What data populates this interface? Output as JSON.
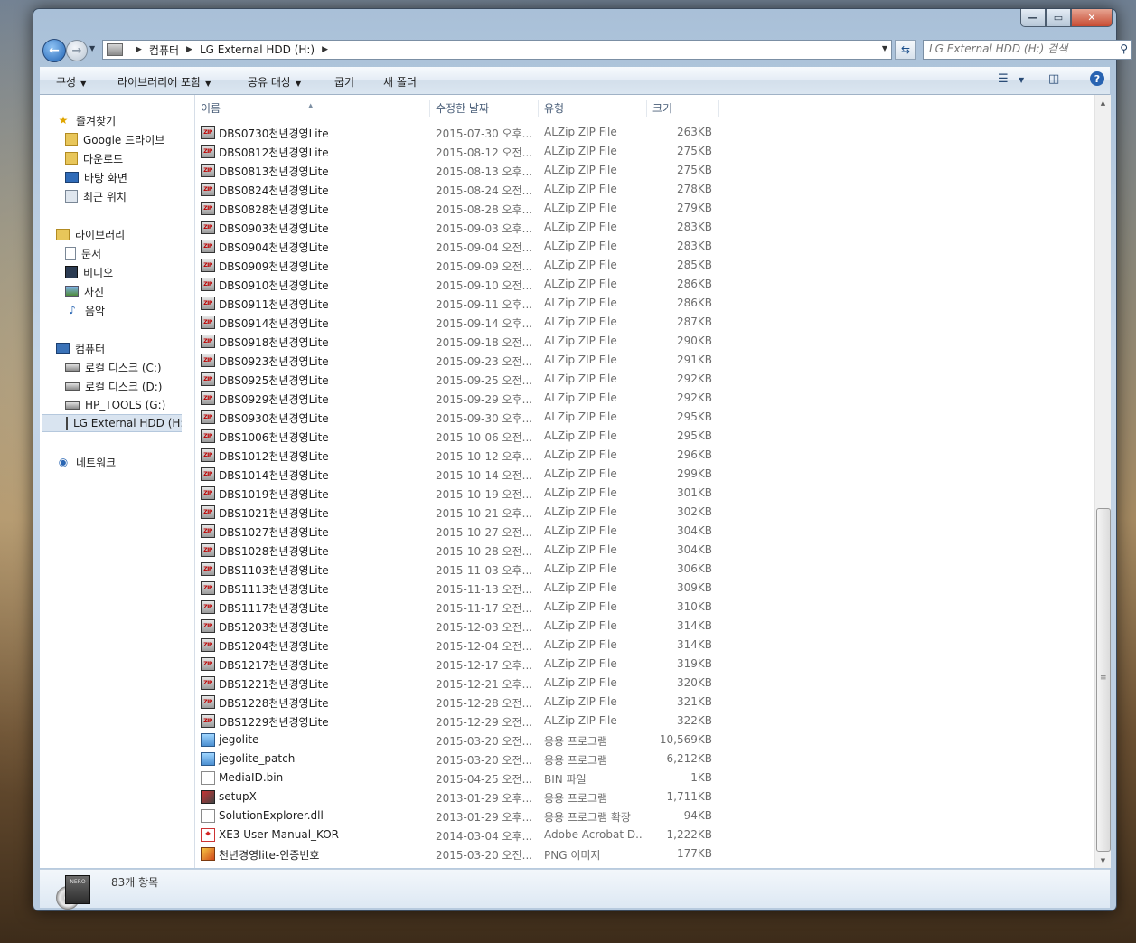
{
  "window": {
    "caption_buttons": {
      "minimize": "—",
      "maximize": "▭",
      "close": "✕"
    }
  },
  "address": {
    "crumbs": [
      "컴퓨터",
      "LG External HDD (H:)"
    ]
  },
  "search": {
    "placeholder": "LG External HDD (H:) 검색"
  },
  "toolbar": {
    "organize": "구성",
    "include_library": "라이브러리에 포함",
    "share_with": "공유 대상",
    "burn": "굽기",
    "new_folder": "새 폴더"
  },
  "nav": {
    "favorites": "즐겨찾기",
    "favorites_items": [
      "Google 드라이브",
      "다운로드",
      "바탕 화면",
      "최근 위치"
    ],
    "libraries": "라이브러리",
    "libraries_items": [
      "문서",
      "비디오",
      "사진",
      "음악"
    ],
    "computer": "컴퓨터",
    "computer_items": [
      "로컬 디스크 (C:)",
      "로컬 디스크 (D:)",
      "HP_TOOLS (G:)",
      "LG External HDD (H:)"
    ],
    "network": "네트워크"
  },
  "columns": {
    "name": "이름",
    "date": "수정한 날짜",
    "type": "유형",
    "size": "크기"
  },
  "files": [
    {
      "name": "DBS0730천년경영Lite",
      "date": "2015-07-30 오후...",
      "type": "ALZip ZIP File",
      "size": "263KB",
      "icon": "zip"
    },
    {
      "name": "DBS0812천년경영Lite",
      "date": "2015-08-12 오전...",
      "type": "ALZip ZIP File",
      "size": "275KB",
      "icon": "zip"
    },
    {
      "name": "DBS0813천년경영Lite",
      "date": "2015-08-13 오후...",
      "type": "ALZip ZIP File",
      "size": "275KB",
      "icon": "zip"
    },
    {
      "name": "DBS0824천년경영Lite",
      "date": "2015-08-24 오전...",
      "type": "ALZip ZIP File",
      "size": "278KB",
      "icon": "zip"
    },
    {
      "name": "DBS0828천년경영Lite",
      "date": "2015-08-28 오후...",
      "type": "ALZip ZIP File",
      "size": "279KB",
      "icon": "zip"
    },
    {
      "name": "DBS0903천년경영Lite",
      "date": "2015-09-03 오후...",
      "type": "ALZip ZIP File",
      "size": "283KB",
      "icon": "zip"
    },
    {
      "name": "DBS0904천년경영Lite",
      "date": "2015-09-04 오전...",
      "type": "ALZip ZIP File",
      "size": "283KB",
      "icon": "zip"
    },
    {
      "name": "DBS0909천년경영Lite",
      "date": "2015-09-09 오전...",
      "type": "ALZip ZIP File",
      "size": "285KB",
      "icon": "zip"
    },
    {
      "name": "DBS0910천년경영Lite",
      "date": "2015-09-10 오전...",
      "type": "ALZip ZIP File",
      "size": "286KB",
      "icon": "zip"
    },
    {
      "name": "DBS0911천년경영Lite",
      "date": "2015-09-11 오후...",
      "type": "ALZip ZIP File",
      "size": "286KB",
      "icon": "zip"
    },
    {
      "name": "DBS0914천년경영Lite",
      "date": "2015-09-14 오후...",
      "type": "ALZip ZIP File",
      "size": "287KB",
      "icon": "zip"
    },
    {
      "name": "DBS0918천년경영Lite",
      "date": "2015-09-18 오전...",
      "type": "ALZip ZIP File",
      "size": "290KB",
      "icon": "zip"
    },
    {
      "name": "DBS0923천년경영Lite",
      "date": "2015-09-23 오전...",
      "type": "ALZip ZIP File",
      "size": "291KB",
      "icon": "zip"
    },
    {
      "name": "DBS0925천년경영Lite",
      "date": "2015-09-25 오전...",
      "type": "ALZip ZIP File",
      "size": "292KB",
      "icon": "zip"
    },
    {
      "name": "DBS0929천년경영Lite",
      "date": "2015-09-29 오후...",
      "type": "ALZip ZIP File",
      "size": "292KB",
      "icon": "zip"
    },
    {
      "name": "DBS0930천년경영Lite",
      "date": "2015-09-30 오후...",
      "type": "ALZip ZIP File",
      "size": "295KB",
      "icon": "zip"
    },
    {
      "name": "DBS1006천년경영Lite",
      "date": "2015-10-06 오전...",
      "type": "ALZip ZIP File",
      "size": "295KB",
      "icon": "zip"
    },
    {
      "name": "DBS1012천년경영Lite",
      "date": "2015-10-12 오후...",
      "type": "ALZip ZIP File",
      "size": "296KB",
      "icon": "zip"
    },
    {
      "name": "DBS1014천년경영Lite",
      "date": "2015-10-14 오전...",
      "type": "ALZip ZIP File",
      "size": "299KB",
      "icon": "zip"
    },
    {
      "name": "DBS1019천년경영Lite",
      "date": "2015-10-19 오전...",
      "type": "ALZip ZIP File",
      "size": "301KB",
      "icon": "zip"
    },
    {
      "name": "DBS1021천년경영Lite",
      "date": "2015-10-21 오후...",
      "type": "ALZip ZIP File",
      "size": "302KB",
      "icon": "zip"
    },
    {
      "name": "DBS1027천년경영Lite",
      "date": "2015-10-27 오전...",
      "type": "ALZip ZIP File",
      "size": "304KB",
      "icon": "zip"
    },
    {
      "name": "DBS1028천년경영Lite",
      "date": "2015-10-28 오전...",
      "type": "ALZip ZIP File",
      "size": "304KB",
      "icon": "zip"
    },
    {
      "name": "DBS1103천년경영Lite",
      "date": "2015-11-03 오후...",
      "type": "ALZip ZIP File",
      "size": "306KB",
      "icon": "zip"
    },
    {
      "name": "DBS1113천년경영Lite",
      "date": "2015-11-13 오전...",
      "type": "ALZip ZIP File",
      "size": "309KB",
      "icon": "zip"
    },
    {
      "name": "DBS1117천년경영Lite",
      "date": "2015-11-17 오전...",
      "type": "ALZip ZIP File",
      "size": "310KB",
      "icon": "zip"
    },
    {
      "name": "DBS1203천년경영Lite",
      "date": "2015-12-03 오전...",
      "type": "ALZip ZIP File",
      "size": "314KB",
      "icon": "zip"
    },
    {
      "name": "DBS1204천년경영Lite",
      "date": "2015-12-04 오전...",
      "type": "ALZip ZIP File",
      "size": "314KB",
      "icon": "zip"
    },
    {
      "name": "DBS1217천년경영Lite",
      "date": "2015-12-17 오후...",
      "type": "ALZip ZIP File",
      "size": "319KB",
      "icon": "zip"
    },
    {
      "name": "DBS1221천년경영Lite",
      "date": "2015-12-21 오후...",
      "type": "ALZip ZIP File",
      "size": "320KB",
      "icon": "zip"
    },
    {
      "name": "DBS1228천년경영Lite",
      "date": "2015-12-28 오전...",
      "type": "ALZip ZIP File",
      "size": "321KB",
      "icon": "zip"
    },
    {
      "name": "DBS1229천년경영Lite",
      "date": "2015-12-29 오전...",
      "type": "ALZip ZIP File",
      "size": "322KB",
      "icon": "zip"
    },
    {
      "name": "jegolite",
      "date": "2015-03-20 오전...",
      "type": "응용 프로그램",
      "size": "10,569KB",
      "icon": "exe"
    },
    {
      "name": "jegolite_patch",
      "date": "2015-03-20 오전...",
      "type": "응용 프로그램",
      "size": "6,212KB",
      "icon": "exe"
    },
    {
      "name": "MediaID.bin",
      "date": "2015-04-25 오전...",
      "type": "BIN 파일",
      "size": "1KB",
      "icon": "blank"
    },
    {
      "name": "setupX",
      "date": "2013-01-29 오후...",
      "type": "응용 프로그램",
      "size": "1,711KB",
      "icon": "setup"
    },
    {
      "name": "SolutionExplorer.dll",
      "date": "2013-01-29 오후...",
      "type": "응용 프로그램 확장",
      "size": "94KB",
      "icon": "dll"
    },
    {
      "name": "XE3 User Manual_KOR",
      "date": "2014-03-04 오후...",
      "type": "Adobe Acrobat D...",
      "size": "1,222KB",
      "icon": "pdf"
    },
    {
      "name": "천년경영lite-인증번호",
      "date": "2015-03-20 오전...",
      "type": "PNG 이미지",
      "size": "177KB",
      "icon": "png"
    }
  ],
  "details": {
    "item_count": "83개 항목",
    "drive_box_label": "NERO"
  }
}
